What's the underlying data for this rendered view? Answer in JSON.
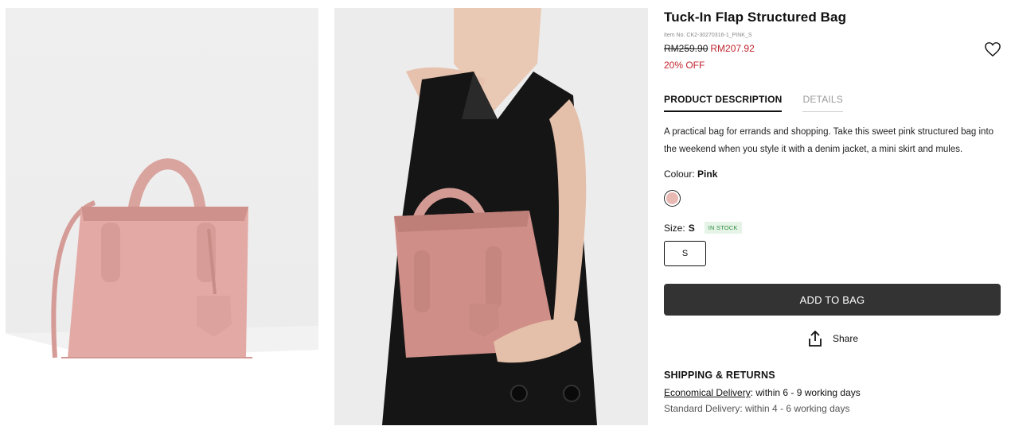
{
  "gallery": {
    "image_1_alt": "Pink structured handbag with crossbody strap on white plinth",
    "image_2_alt": "Model in black sleeveless blazer dress holding pink structured handbag"
  },
  "product": {
    "title": "Tuck-In Flap Structured Bag",
    "item_no": "Item No. CK2-30270316-1_PINK_S",
    "original_price": "RM259.90",
    "sale_price": "RM207.92",
    "discount": "20% OFF"
  },
  "tabs": [
    {
      "label": "PRODUCT DESCRIPTION",
      "active": true
    },
    {
      "label": "DETAILS",
      "active": false
    }
  ],
  "description": "A practical bag for errands and shopping. Take this sweet pink structured bag into the weekend when you style it with a denim jacket, a mini skirt and mules.",
  "colour": {
    "label": "Colour:",
    "value": "Pink",
    "swatch_color": "#e8b8b3"
  },
  "size": {
    "label": "Size:",
    "value": "S",
    "stock_badge": "IN STOCK",
    "options": [
      "S"
    ]
  },
  "actions": {
    "add_to_bag": "ADD TO BAG",
    "share": "Share"
  },
  "shipping": {
    "title": "SHIPPING & RETURNS",
    "economical_link": "Economical Delivery",
    "economical_text": ": within 6 - 9 working days",
    "cut_line": "Standard Delivery: within 4 - 6 working days"
  },
  "colors": {
    "accent_red": "#c0252e",
    "button_dark": "#333333",
    "stock_green": "#2d8b3e"
  }
}
